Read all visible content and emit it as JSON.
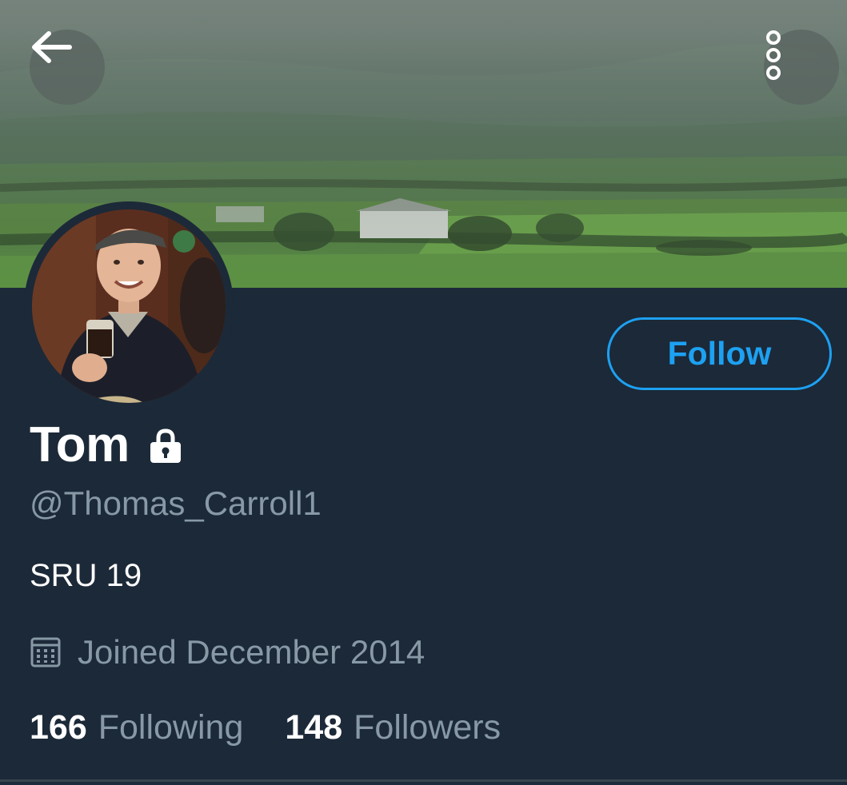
{
  "header": {
    "back_icon": "arrow-left-icon",
    "more_icon": "more-vertical-icon"
  },
  "profile": {
    "display_name": "Tom",
    "protected_icon": "lock-icon",
    "handle": "@Thomas_Carroll1",
    "bio": "SRU 19",
    "joined_icon": "calendar-icon",
    "joined_text": "Joined December 2014",
    "following_count": "166",
    "following_label": "Following",
    "followers_count": "148",
    "followers_label": "Followers"
  },
  "actions": {
    "follow_label": "Follow"
  },
  "colors": {
    "background": "#1c2938",
    "accent": "#1da1f2",
    "muted_text": "#8899a6",
    "primary_text": "#ffffff"
  }
}
